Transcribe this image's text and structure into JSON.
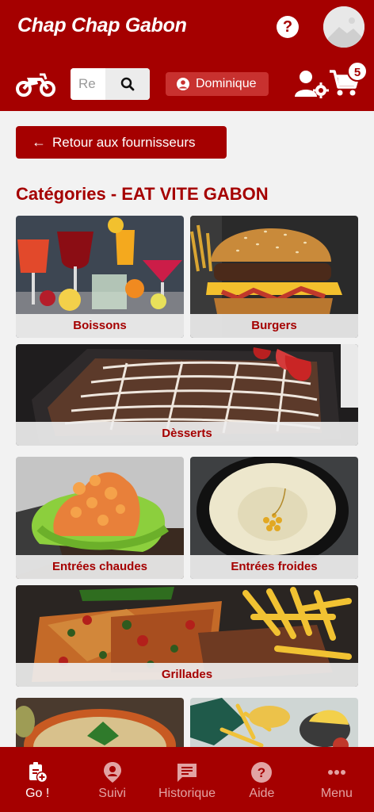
{
  "header": {
    "title": "Chap Chap Gabon",
    "help_label": "?",
    "search_placeholder": "Re",
    "user_name": "Dominique",
    "cart_count": "5"
  },
  "back_button": {
    "arrow": "←",
    "label": "Retour aux fournisseurs"
  },
  "page_title": "Catégories - EAT VITE GABON",
  "categories": [
    {
      "label": "Boissons"
    },
    {
      "label": "Burgers"
    },
    {
      "label": "Dèsserts"
    },
    {
      "label": "Entrées chaudes"
    },
    {
      "label": "Entrées froides"
    },
    {
      "label": "Grillades"
    }
  ],
  "nav": [
    {
      "label": "Go !",
      "icon": "clipboard-plus-icon",
      "active": true
    },
    {
      "label": "Suivi",
      "icon": "location-pin-icon",
      "active": false
    },
    {
      "label": "Historique",
      "icon": "message-list-icon",
      "active": false
    },
    {
      "label": "Aide",
      "icon": "help-circle-icon",
      "active": false
    },
    {
      "label": "Menu",
      "icon": "more-dots-icon",
      "active": false
    }
  ],
  "colors": {
    "brand": "#a50000",
    "chip": "#c8312f",
    "background": "#f2f2f2"
  }
}
